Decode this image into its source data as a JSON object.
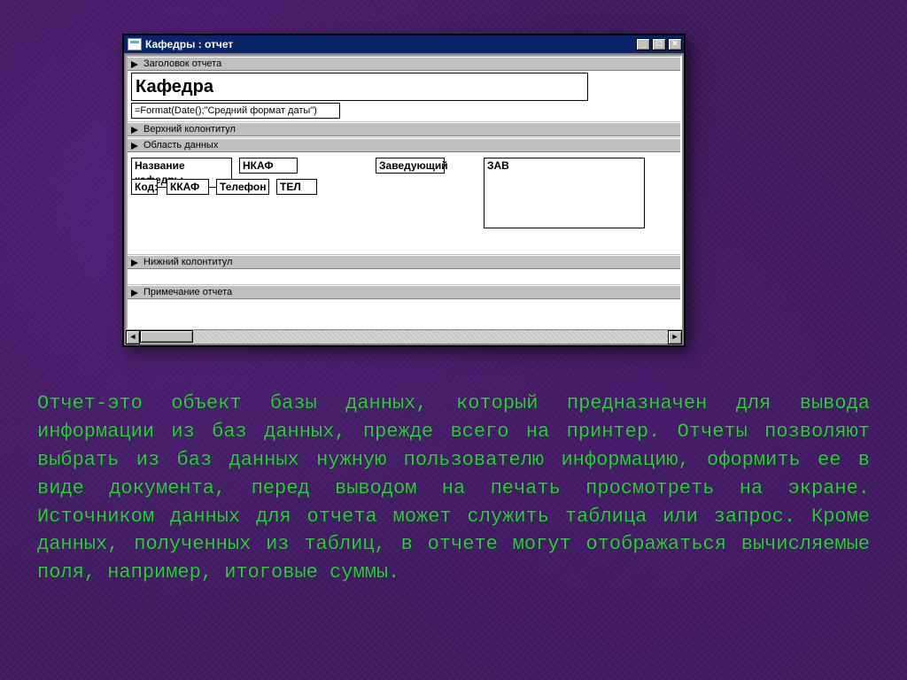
{
  "window": {
    "title": "Кафедры : отчет",
    "buttons": {
      "min": "_",
      "max": "□",
      "close": "×"
    }
  },
  "sections": {
    "report_header": "Заголовок отчета",
    "page_header": "Верхний колонтитул",
    "detail": "Область данных",
    "page_footer": "Нижний колонтитул",
    "report_footer": "Примечание отчета"
  },
  "controls": {
    "title_label": "Кафедра",
    "date_expr": "=Format(Date();\"Средний формат даты\")",
    "name_lbl": "Название кафедры",
    "name_fld": "НКАФ",
    "head_lbl": "Заведующий",
    "head_fld": "ЗАВ",
    "code_lbl": "Код:",
    "code_fld": "ККАФ",
    "tel_lbl": "Телефон",
    "tel_fld": "ТЕЛ"
  },
  "paragraph": "Отчет-это объект базы данных, который предназначен для вывода информации из баз данных, прежде всего на принтер. Отчеты позволяют выбрать из баз данных нужную пользователю информацию, оформить ее в виде документа, перед выводом на печать просмотреть на экране. Источником данных для отчета может служить таблица или запрос. Кроме данных, полученных из таблиц, в отчете могут отображаться вычисляемые поля, например, итоговые суммы."
}
